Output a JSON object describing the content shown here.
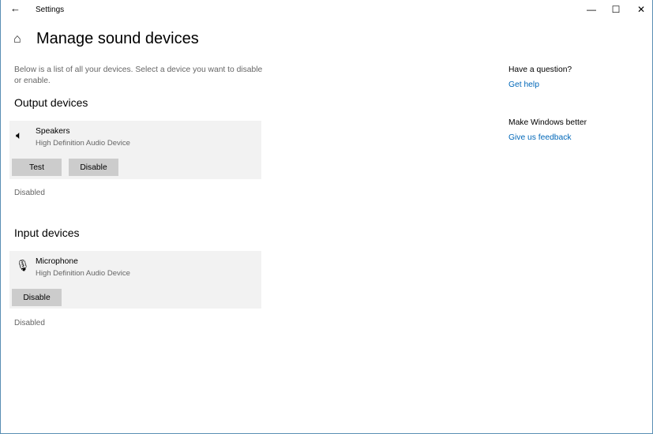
{
  "window": {
    "title": "Settings",
    "minimize": "—",
    "maximize": "☐",
    "close": "✕",
    "back": "←"
  },
  "page": {
    "title": "Manage sound devices",
    "description": "Below is a list of all your devices. Select a device you want to disable or enable."
  },
  "output": {
    "heading": "Output devices",
    "device": {
      "name": "Speakers",
      "type": "High Definition Audio Device"
    },
    "test_label": "Test",
    "disable_label": "Disable",
    "status": "Disabled"
  },
  "input": {
    "heading": "Input devices",
    "device": {
      "name": "Microphone",
      "type": "High Definition Audio Device"
    },
    "disable_label": "Disable",
    "status": "Disabled"
  },
  "side": {
    "question": "Have a question?",
    "help": "Get help",
    "better": "Make Windows better",
    "feedback": "Give us feedback"
  }
}
